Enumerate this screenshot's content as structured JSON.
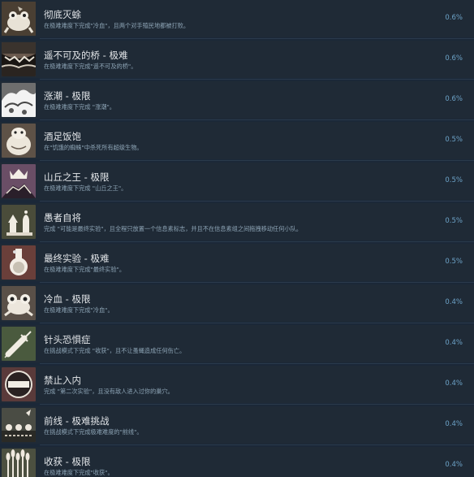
{
  "achievements": [
    {
      "title": "彻底灭蜍",
      "desc": "在极难难度下完成\"冷血\"，且两个对手殖民地都被打败。",
      "pct": "0.6%",
      "icon": "frog-rider-icon"
    },
    {
      "title": "遥不可及的桥 - 极难",
      "desc": "在极难难度下完成\"遥不可及的桥\"。",
      "pct": "0.6%",
      "icon": "broken-bridge-icon"
    },
    {
      "title": "涨潮 - 极限",
      "desc": "在极难难度下完成 \"涨潮\"。",
      "pct": "0.6%",
      "icon": "tidal-wave-icon"
    },
    {
      "title": "酒足饭饱",
      "desc": "在\"饥饿的蜘蛛\"中杀死所有超级生物。",
      "pct": "0.5%",
      "icon": "fat-creature-icon"
    },
    {
      "title": "山丘之王 - 极限",
      "desc": "在极难难度下完成 \"山丘之王\"。",
      "pct": "0.5%",
      "icon": "crown-hill-icon"
    },
    {
      "title": "愚者自将",
      "desc": "完成 \"可能是最终实验\"，且全程只放置一个信息素标志，并且不在信息素组之间拖拽移动任何小队。",
      "pct": "0.5%",
      "icon": "chess-pieces-icon"
    },
    {
      "title": "最终实验 - 极难",
      "desc": "在极难难度下完成\"最终实验\"。",
      "pct": "0.5%",
      "icon": "flask-icon"
    },
    {
      "title": "冷血 - 极限",
      "desc": "在极难难度下完成\"冷血\"。",
      "pct": "0.4%",
      "icon": "frog-icon"
    },
    {
      "title": "针头恐惧症",
      "desc": "在挑战模式下完成 \"收获\"，且不让蚤蝇造成任何伤亡。",
      "pct": "0.4%",
      "icon": "syringe-icon"
    },
    {
      "title": "禁止入内",
      "desc": "完成 \"第二次实验\"，且没有敌人进入过你的巢穴。",
      "pct": "0.4%",
      "icon": "no-entry-icon"
    },
    {
      "title": "前线 - 极难挑战",
      "desc": "在挑战模式下完成极难难度的\"前线\"。",
      "pct": "0.4%",
      "icon": "front-line-icon"
    },
    {
      "title": "收获 - 极限",
      "desc": "在极难难度下完成\"收获\"。",
      "pct": "0.4%",
      "icon": "wheat-harvest-icon"
    }
  ]
}
